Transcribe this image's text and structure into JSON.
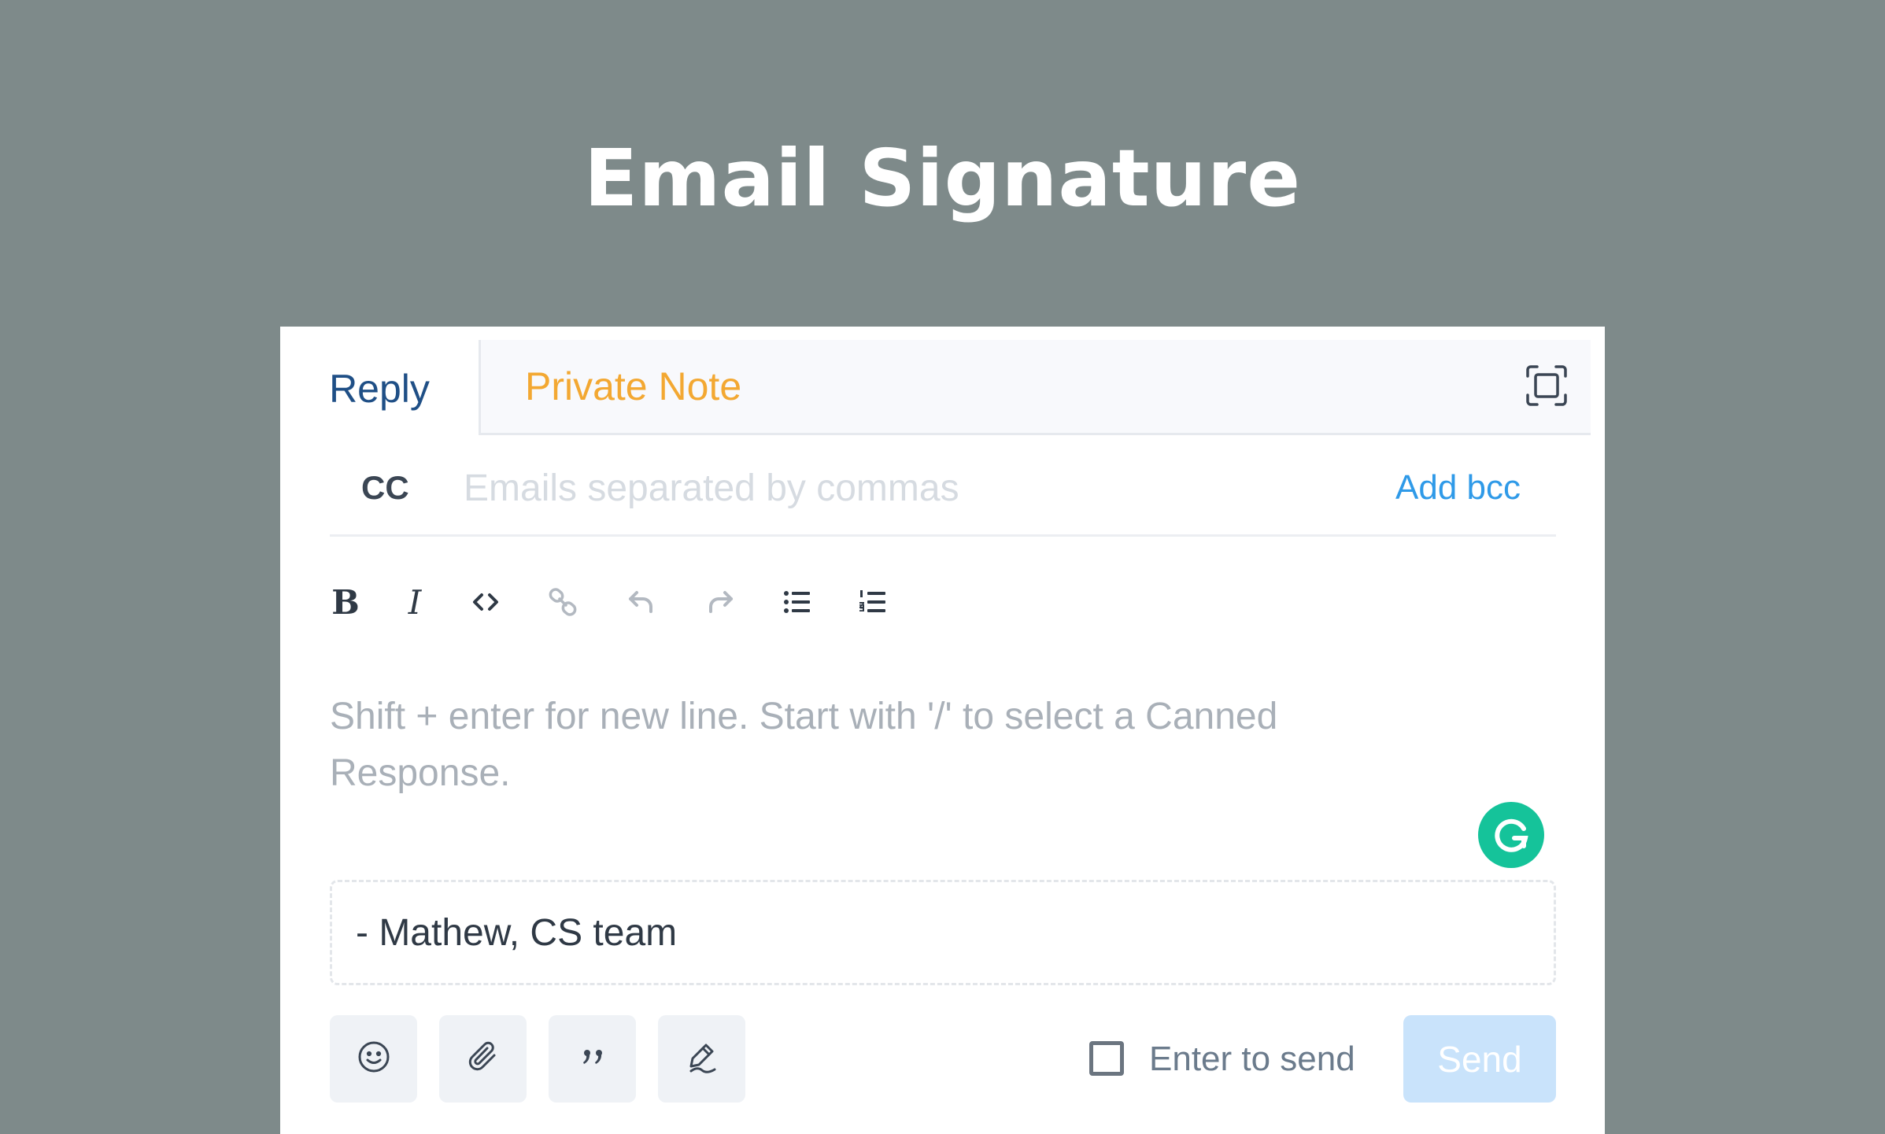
{
  "banner": {
    "title": "Email Signature"
  },
  "tabs": {
    "reply_label": "Reply",
    "private_note_label": "Private Note",
    "expand_icon": "expand-icon"
  },
  "cc": {
    "label": "CC",
    "placeholder": "Emails separated by commas",
    "add_bcc_label": "Add bcc"
  },
  "toolbar": {
    "bold_label": "B",
    "italic_label": "I",
    "icons": [
      "code-icon",
      "link-icon",
      "undo-icon",
      "redo-icon",
      "bullet-list-icon",
      "numbered-list-icon"
    ]
  },
  "editor": {
    "placeholder": "Shift + enter for new line. Start with '/' to select a Canned Response.",
    "signature": "- Mathew, CS team",
    "grammarly_icon": "grammarly-icon"
  },
  "actions": {
    "icons": [
      "emoji-icon",
      "attachment-icon",
      "quote-icon",
      "signature-icon"
    ],
    "enter_to_send_label": "Enter to send",
    "enter_to_send_checked": false,
    "send_label": "Send"
  },
  "colors": {
    "background": "#7e8a8a",
    "reply_tab": "#1f4f86",
    "private_note_tab": "#f3a832",
    "link_accent": "#2f9ae8",
    "grammarly": "#15c39a",
    "send_disabled": "#c9e3fb"
  }
}
